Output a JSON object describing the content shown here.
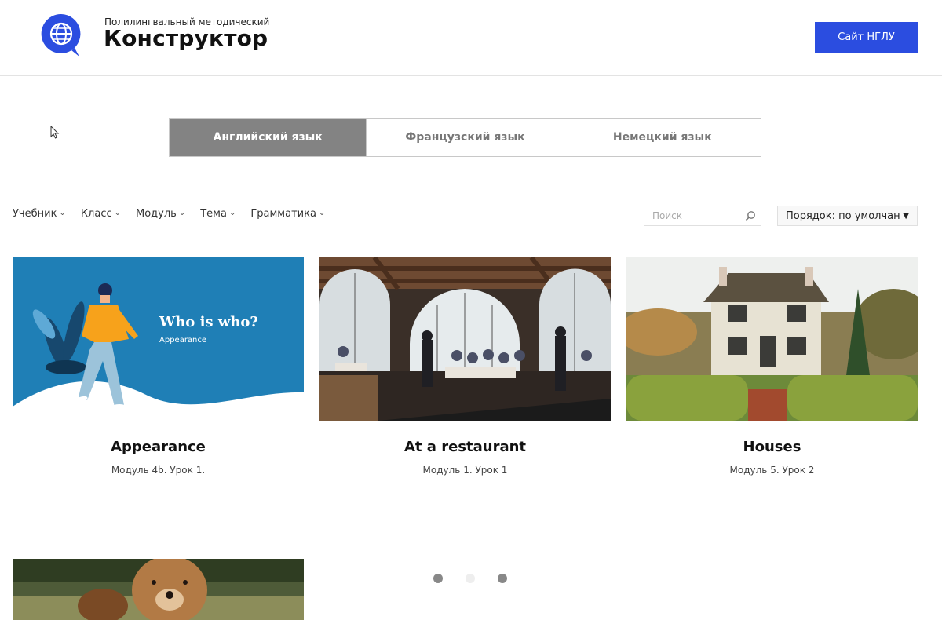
{
  "header": {
    "logo_subtitle": "Полилингвальный методический",
    "logo_title": "Конструктор",
    "site_button": "Сайт НГЛУ"
  },
  "languages": [
    {
      "label": "Английский язык",
      "active": true
    },
    {
      "label": "Французский язык",
      "active": false
    },
    {
      "label": "Немецкий язык",
      "active": false
    }
  ],
  "filters": [
    "Учебник",
    "Класс",
    "Модуль",
    "Тема",
    "Грамматика"
  ],
  "search": {
    "placeholder": "Поиск"
  },
  "sort": {
    "label": "Порядок: по умолчан"
  },
  "cards": [
    {
      "title": "Appearance",
      "subtitle": "Модуль 4b. Урок 1.",
      "image_title": "Who is who?",
      "image_caption": "Appearance"
    },
    {
      "title": "At a restaurant",
      "subtitle": "Модуль 1. Урок 1"
    },
    {
      "title": "Houses",
      "subtitle": "Модуль 5. Урок 2"
    }
  ],
  "pagination": {
    "count": 3,
    "current": 2
  },
  "colors": {
    "accent": "#2b4de0",
    "active_tab": "#838383",
    "card1_bg": "#1f7fb6"
  }
}
